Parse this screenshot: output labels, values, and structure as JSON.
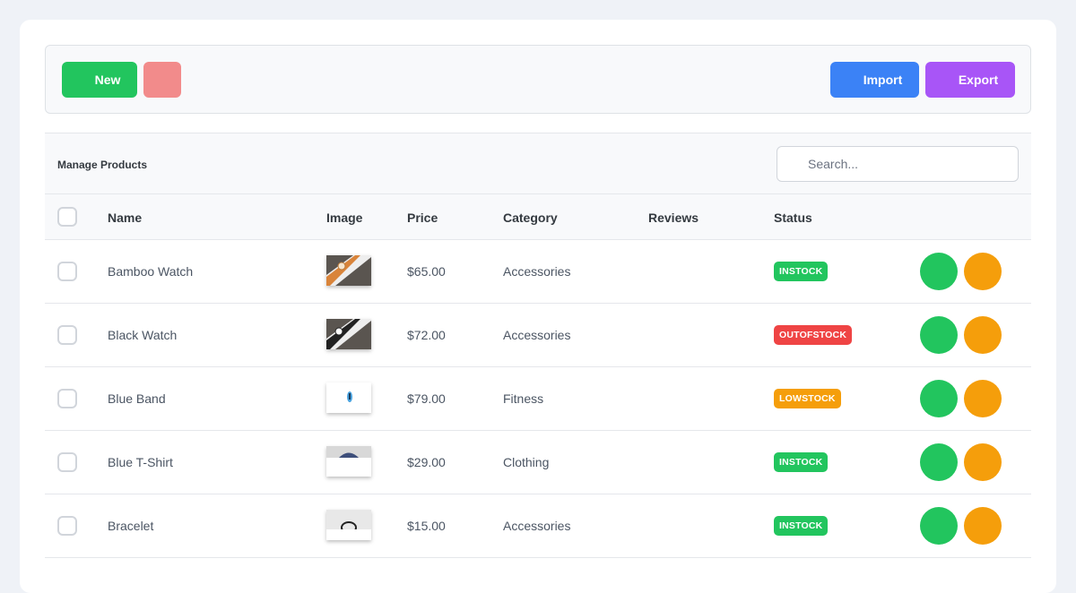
{
  "toolbar": {
    "new_label": "New",
    "delete_label": "",
    "import_label": "Import",
    "export_label": "Export"
  },
  "table": {
    "title": "Manage Products",
    "search_placeholder": "Search...",
    "columns": [
      "Name",
      "Image",
      "Price",
      "Category",
      "Reviews",
      "Status"
    ],
    "rows": [
      {
        "name": "Bamboo Watch",
        "image": "bamboo-watch",
        "price": "$65.00",
        "category": "Accessories",
        "reviews": "",
        "status": "INSTOCK"
      },
      {
        "name": "Black Watch",
        "image": "black-watch",
        "price": "$72.00",
        "category": "Accessories",
        "reviews": "",
        "status": "OUTOFSTOCK"
      },
      {
        "name": "Blue Band",
        "image": "blue-band",
        "price": "$79.00",
        "category": "Fitness",
        "reviews": "",
        "status": "LOWSTOCK"
      },
      {
        "name": "Blue T-Shirt",
        "image": "blue-t-shirt",
        "price": "$29.00",
        "category": "Clothing",
        "reviews": "",
        "status": "INSTOCK"
      },
      {
        "name": "Bracelet",
        "image": "bracelet",
        "price": "$15.00",
        "category": "Accessories",
        "reviews": "",
        "status": "INSTOCK"
      }
    ]
  },
  "colors": {
    "instock": "#22c55e",
    "outofstock": "#ef4444",
    "lowstock": "#f59e0b",
    "edit_action": "#22c55e",
    "delete_action": "#f59e0b"
  }
}
